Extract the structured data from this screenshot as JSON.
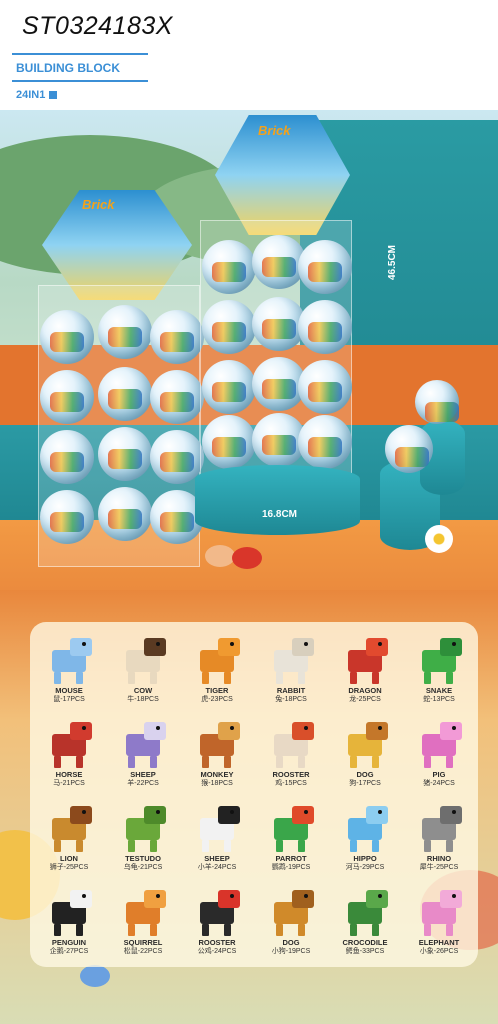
{
  "header": {
    "code": "ST0324183X",
    "subtitle": "BUILDING BLOCK",
    "count": "24IN1"
  },
  "scene": {
    "brand_left": "Brick",
    "brand_right": "Brick",
    "dim_height": "46.5CM",
    "dim_width": "16.8CM"
  },
  "colors": {
    "accent": "#3b8fd6",
    "wall_orange": "#e3742e",
    "wall_teal": "#1e8590"
  },
  "animals": [
    {
      "name": "MOUSE",
      "pcs": "鼠-17PCS",
      "color": "#7fb7e8",
      "head": "#9ccaf0"
    },
    {
      "name": "COW",
      "pcs": "牛-18PCS",
      "color": "#e8d9bf",
      "head": "#5a3a22"
    },
    {
      "name": "TIGER",
      "pcs": "虎-23PCS",
      "color": "#e68a26",
      "head": "#f09a30"
    },
    {
      "name": "RABBIT",
      "pcs": "兔-18PCS",
      "color": "#e8e3d8",
      "head": "#d8cfbd"
    },
    {
      "name": "DRAGON",
      "pcs": "龙-25PCS",
      "color": "#c9362a",
      "head": "#e24a2e"
    },
    {
      "name": "SNAKE",
      "pcs": "蛇-13PCS",
      "color": "#3fae47",
      "head": "#2e8f3a"
    },
    {
      "name": "HORSE",
      "pcs": "马-21PCS",
      "color": "#b8332a",
      "head": "#d13b2e"
    },
    {
      "name": "SHEEP",
      "pcs": "羊-22PCS",
      "color": "#8e7ac9",
      "head": "#d9d2ee"
    },
    {
      "name": "MONKEY",
      "pcs": "猴-18PCS",
      "color": "#c0652a",
      "head": "#e0a24a"
    },
    {
      "name": "ROOSTER",
      "pcs": "鸡-15PCS",
      "color": "#e8d9c5",
      "head": "#d94f2a"
    },
    {
      "name": "DOG",
      "pcs": "狗-17PCS",
      "color": "#e6b43a",
      "head": "#c4772a"
    },
    {
      "name": "PIG",
      "pcs": "猪-24PCS",
      "color": "#e06fc0",
      "head": "#f29ad6"
    },
    {
      "name": "LION",
      "pcs": "狮子-25PCS",
      "color": "#c98a2e",
      "head": "#8c4a1c"
    },
    {
      "name": "TESTUDO",
      "pcs": "乌龟-21PCS",
      "color": "#6aa83a",
      "head": "#4e8a2a"
    },
    {
      "name": "SHEEP",
      "pcs": "小羊-24PCS",
      "color": "#f2f2f2",
      "head": "#222222"
    },
    {
      "name": "PARROT",
      "pcs": "鹦鹉-19PCS",
      "color": "#3aa64a",
      "head": "#e04a2a"
    },
    {
      "name": "HIPPO",
      "pcs": "河马-29PCS",
      "color": "#5eb3e6",
      "head": "#8ccdf0"
    },
    {
      "name": "RHINO",
      "pcs": "犀牛-25PCS",
      "color": "#8e8e8e",
      "head": "#6e6e6e"
    },
    {
      "name": "PENGUIN",
      "pcs": "企鹅-27PCS",
      "color": "#222222",
      "head": "#f2f2f2"
    },
    {
      "name": "SQUIRREL",
      "pcs": "松鼠-22PCS",
      "color": "#e07e2a",
      "head": "#f0a040"
    },
    {
      "name": "ROOSTER",
      "pcs": "公鸡-24PCS",
      "color": "#2a2a2a",
      "head": "#d9342a"
    },
    {
      "name": "DOG",
      "pcs": "小狗-19PCS",
      "color": "#d08a2a",
      "head": "#a0601e"
    },
    {
      "name": "CROCODILE",
      "pcs": "鳄鱼-33PCS",
      "color": "#3a8a3a",
      "head": "#5aa84a"
    },
    {
      "name": "ELEPHANT",
      "pcs": "小象-26PCS",
      "color": "#e88ac8",
      "head": "#f2aad8"
    }
  ]
}
